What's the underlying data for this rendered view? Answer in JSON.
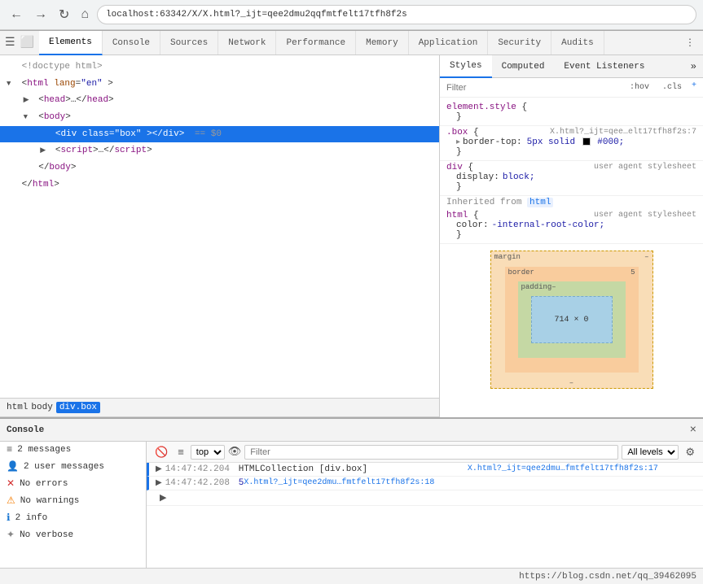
{
  "browser": {
    "nav_back": "←",
    "nav_forward": "→",
    "nav_reload": "↻",
    "nav_home": "⌂",
    "address": "localhost:63342/X/X.html?_ijt=qee2dmu2qqfmtfelt17tfh8f2s"
  },
  "devtools": {
    "tabs": [
      {
        "id": "elements",
        "label": "Elements",
        "active": true
      },
      {
        "id": "console",
        "label": "Console",
        "active": false
      },
      {
        "id": "sources",
        "label": "Sources",
        "active": false
      },
      {
        "id": "network",
        "label": "Network",
        "active": false
      },
      {
        "id": "performance",
        "label": "Performance",
        "active": false
      },
      {
        "id": "memory",
        "label": "Memory",
        "active": false
      },
      {
        "id": "application",
        "label": "Application",
        "active": false
      },
      {
        "id": "security",
        "label": "Security",
        "active": false
      },
      {
        "id": "audits",
        "label": "Audits",
        "active": false
      }
    ],
    "more_icon": "⋮"
  },
  "elements_panel": {
    "dom_lines": [
      {
        "id": "doctype",
        "text": "<!doctype html>",
        "indent": 0,
        "selected": false
      },
      {
        "id": "html-open",
        "text": "<html lang=\"en\">",
        "indent": 0,
        "selected": false,
        "has_triangle": true,
        "open": true
      },
      {
        "id": "head",
        "text": "<head>…</head>",
        "indent": 1,
        "selected": false,
        "has_triangle": true
      },
      {
        "id": "body-open",
        "text": "<body>",
        "indent": 1,
        "selected": false,
        "has_triangle": true,
        "open": true
      },
      {
        "id": "div",
        "text": "<div class=\"box\"></div>",
        "indent": 2,
        "selected": true,
        "equals": "== $0"
      },
      {
        "id": "script",
        "text": "<script>…</script>",
        "indent": 2,
        "selected": false,
        "has_triangle": true
      },
      {
        "id": "body-close",
        "text": "</body>",
        "indent": 1,
        "selected": false
      },
      {
        "id": "html-close",
        "text": "</html>",
        "indent": 0,
        "selected": false
      }
    ],
    "breadcrumb": [
      {
        "id": "html",
        "label": "html",
        "active": false
      },
      {
        "id": "body",
        "label": "body",
        "active": false
      },
      {
        "id": "divbox",
        "label": "div.box",
        "active": true
      }
    ]
  },
  "styles_panel": {
    "tabs": [
      {
        "id": "styles",
        "label": "Styles",
        "active": true
      },
      {
        "id": "computed",
        "label": "Computed",
        "active": false
      },
      {
        "id": "event-listeners",
        "label": "Event Listeners",
        "active": false
      }
    ],
    "filter_placeholder": "Filter",
    "filter_buttons": [
      ":hov",
      ".cls"
    ],
    "filter_add": "+",
    "rules": [
      {
        "selector": "element.style {",
        "close": "}",
        "source": "",
        "properties": []
      },
      {
        "selector": ".box {",
        "close": "}",
        "source": "X.html?_ijt=qee…elt17tfh8f2s:7",
        "properties": [
          {
            "name": "border-top:",
            "value": "5px solid",
            "has_swatch": true,
            "swatch_color": "#000000",
            "extra": "#000;"
          }
        ]
      },
      {
        "selector": "div {",
        "close": "}",
        "source": "user agent stylesheet",
        "properties": [
          {
            "name": "display:",
            "value": "block;",
            "has_swatch": false
          }
        ]
      }
    ],
    "inherited_header": "Inherited from",
    "inherited_element": "html",
    "inherited_rules": [
      {
        "selector": "html {",
        "close": "}",
        "source": "user agent stylesheet",
        "properties": [
          {
            "name": "color:",
            "value": "-internal-root-color;",
            "has_swatch": false
          }
        ]
      }
    ],
    "box_model": {
      "margin_label": "margin",
      "border_label": "border",
      "border_value": "5",
      "padding_label": "padding-",
      "content_dim": "714 × 0",
      "dash": "-"
    }
  },
  "console": {
    "title": "Console",
    "close_icon": "×",
    "toolbar": {
      "clear_icon": "🚫",
      "filter_icon": "≡",
      "top_label": "top",
      "eye_icon": "👁",
      "filter_placeholder": "Filter",
      "all_levels": "All levels",
      "settings_icon": "⚙"
    },
    "sidebar_items": [
      {
        "id": "messages",
        "label": "2 messages",
        "icon": "≡",
        "type": "msg"
      },
      {
        "id": "user-messages",
        "label": "2 user messages",
        "icon": "👤",
        "type": "user"
      },
      {
        "id": "errors",
        "label": "No errors",
        "icon": "✕",
        "type": "error"
      },
      {
        "id": "warnings",
        "label": "No warnings",
        "icon": "⚠",
        "type": "warn"
      },
      {
        "id": "info",
        "label": "2 info",
        "icon": "ℹ",
        "type": "info"
      },
      {
        "id": "verbose",
        "label": "No verbose",
        "icon": "✦",
        "type": "verbose"
      }
    ],
    "messages": [
      {
        "id": "msg1",
        "time": "14:47:42.204",
        "icon": "▶",
        "text": "HTMLCollection [div.box]",
        "link": "X.html?_ijt=qee2dmu…fmtfelt17tfh8f2s:17",
        "type": "info"
      },
      {
        "id": "msg2",
        "time": "14:47:42.208",
        "icon": "▶",
        "number": "5",
        "link": "X.html?_ijt=qee2dmu…fmtfelt17tfh8f2s:18",
        "type": "info"
      }
    ],
    "expand_row": "▶"
  },
  "status_bar": {
    "right_text": "https://blog.csdn.net/qq_39462095"
  }
}
